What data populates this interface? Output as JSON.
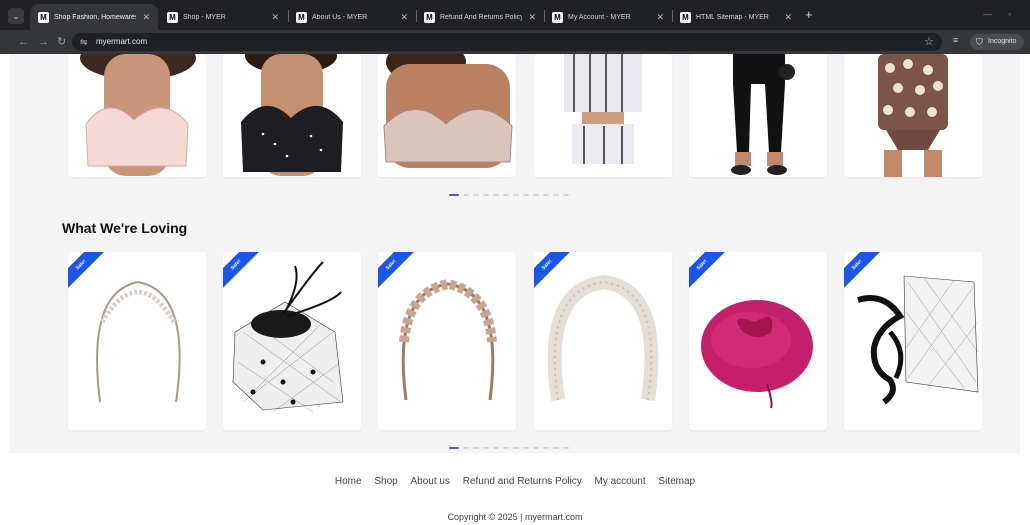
{
  "browser": {
    "tabs": [
      {
        "title": "Shop Fashion, Homewares, Bea",
        "active": true
      },
      {
        "title": "Shop - MYER",
        "active": false
      },
      {
        "title": "About Us - MYER",
        "active": false
      },
      {
        "title": "Refund And Returns Policy - M",
        "active": false
      },
      {
        "title": "My Account - MYER",
        "active": false
      },
      {
        "title": "HTML Sitemap - MYER",
        "active": false
      }
    ],
    "url": "myermart.com",
    "incognito_label": "Incognito"
  },
  "page": {
    "section_title": "What We're Loving",
    "sale_badge": "Sale!",
    "carousel_dots": 12,
    "footer_links": [
      "Home",
      "Shop",
      "About us",
      "Refund and Returns Policy",
      "My account",
      "Sitemap"
    ],
    "copyright": "Copyright © 2025 | myermart.com"
  },
  "colors": {
    "sale_badge": "#1a56e8",
    "dot_active": "#6b4dde",
    "section_bg": "#f4f4f5"
  }
}
